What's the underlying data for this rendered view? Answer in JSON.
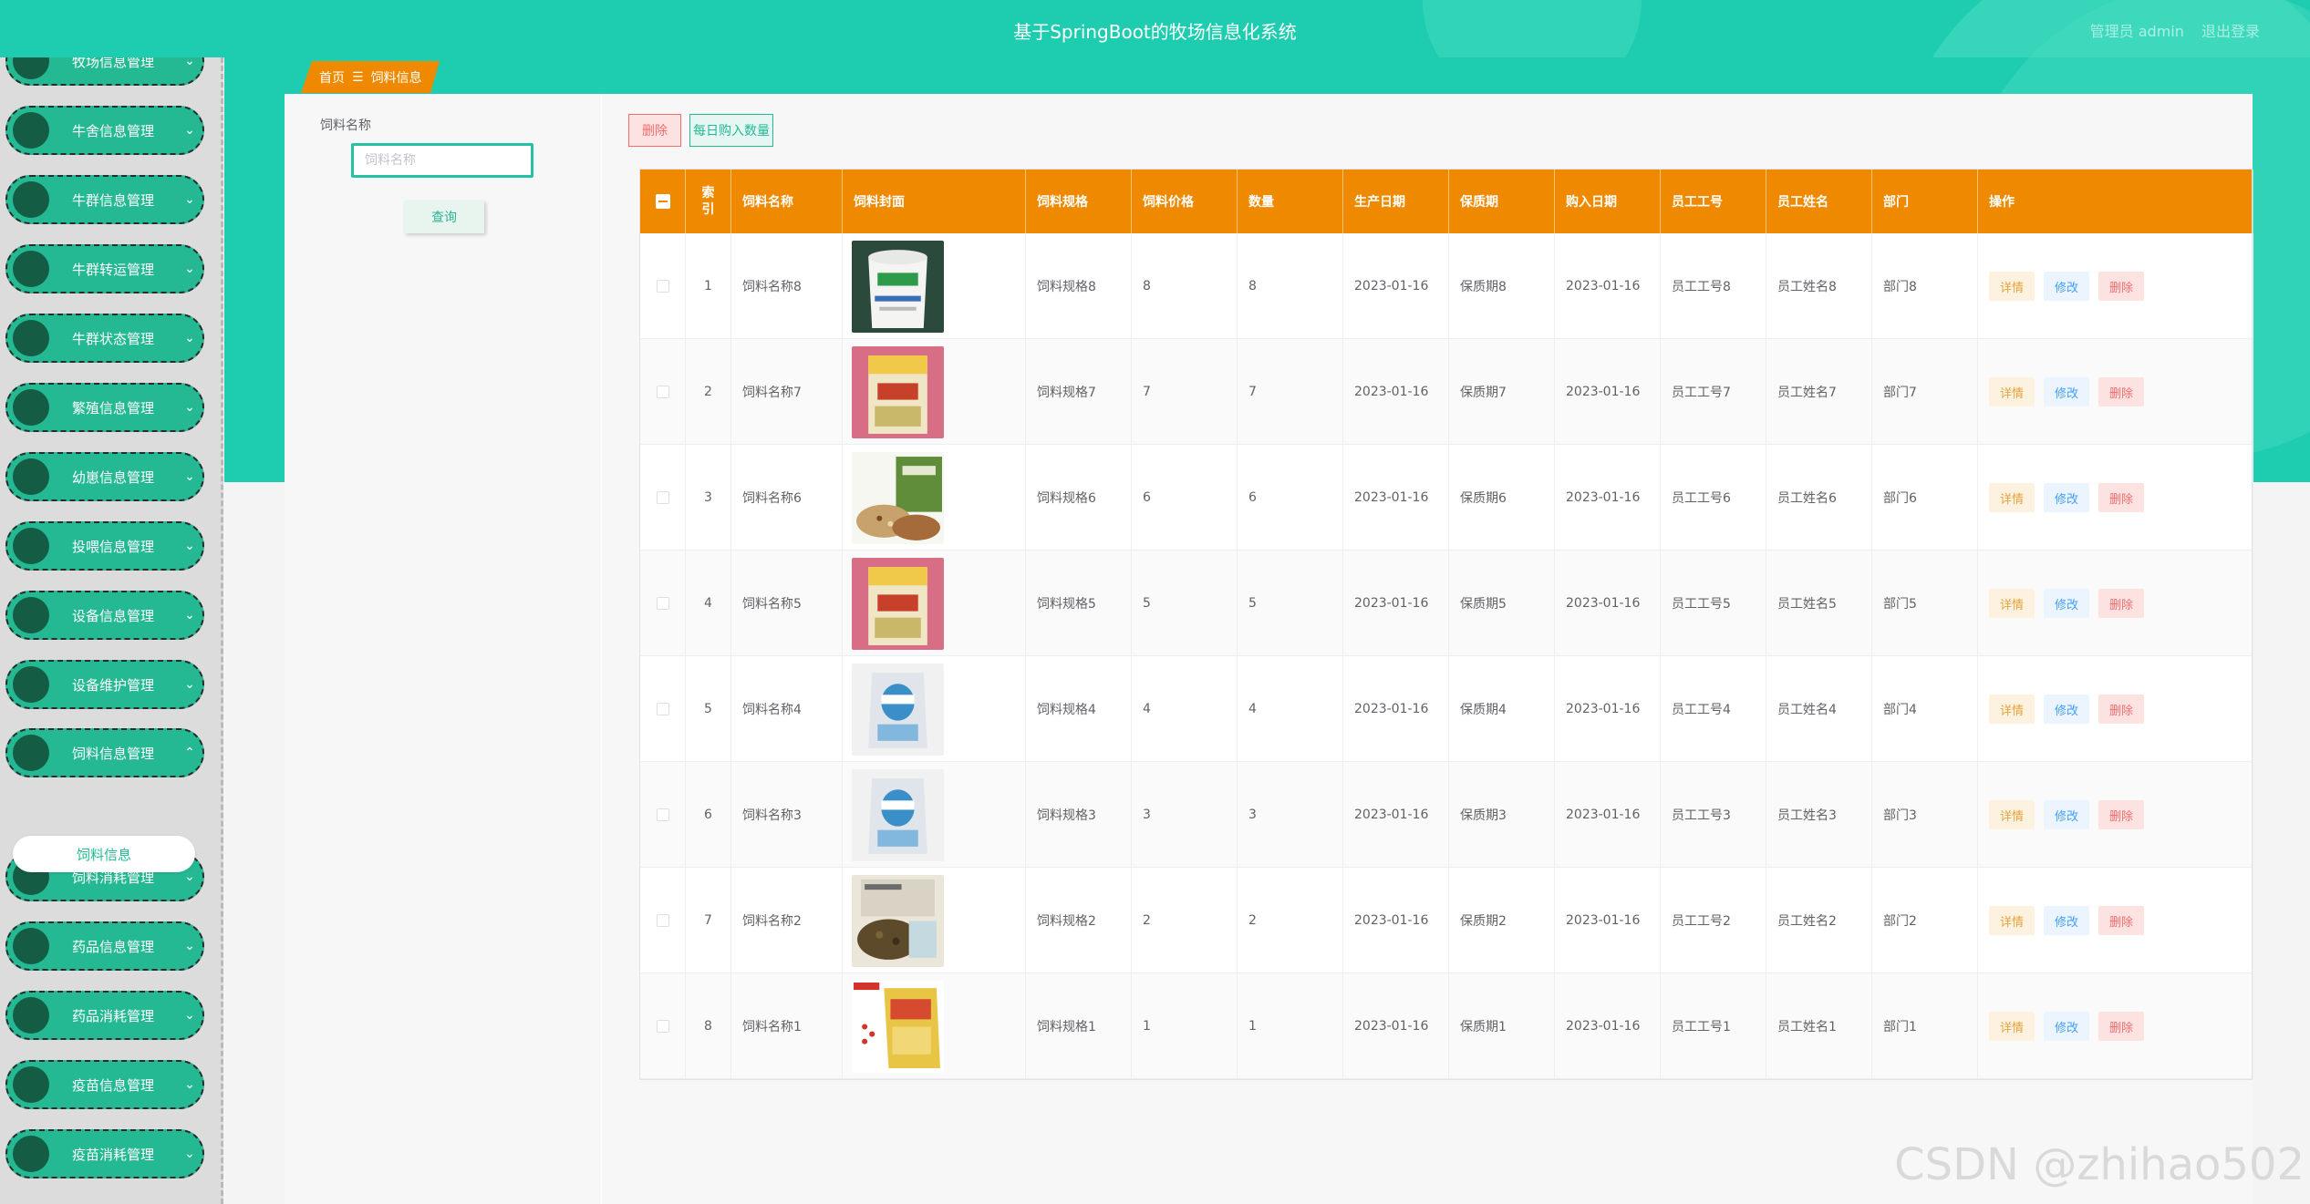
{
  "header": {
    "title": "基于SpringBoot的牧场信息化系统",
    "user_label": "管理员 admin",
    "logout_label": "退出登录"
  },
  "sidebar": {
    "items": [
      {
        "label": "牧场信息管理",
        "chevron": "chevron-down-icon"
      },
      {
        "label": "牛舍信息管理",
        "chevron": "chevron-down-icon"
      },
      {
        "label": "牛群信息管理",
        "chevron": "chevron-down-icon"
      },
      {
        "label": "牛群转运管理",
        "chevron": "chevron-down-icon"
      },
      {
        "label": "牛群状态管理",
        "chevron": "chevron-down-icon"
      },
      {
        "label": "繁殖信息管理",
        "chevron": "chevron-down-icon"
      },
      {
        "label": "幼崽信息管理",
        "chevron": "chevron-down-icon"
      },
      {
        "label": "投喂信息管理",
        "chevron": "chevron-down-icon"
      },
      {
        "label": "设备信息管理",
        "chevron": "chevron-down-icon"
      },
      {
        "label": "设备维护管理",
        "chevron": "chevron-down-icon"
      },
      {
        "label": "饲料信息管理",
        "chevron": "chevron-up-icon",
        "expanded": true
      },
      {
        "label": "饲料消耗管理",
        "chevron": "chevron-down-icon"
      },
      {
        "label": "药品信息管理",
        "chevron": "chevron-down-icon"
      },
      {
        "label": "药品消耗管理",
        "chevron": "chevron-down-icon"
      },
      {
        "label": "疫苗信息管理",
        "chevron": "chevron-down-icon"
      },
      {
        "label": "疫苗消耗管理",
        "chevron": "chevron-down-icon"
      }
    ],
    "active_sub_item": "饲料信息"
  },
  "breadcrumb": {
    "home": "首页",
    "separator": "☰",
    "current": "饲料信息"
  },
  "search": {
    "label": "饲料名称",
    "placeholder": "饲料名称",
    "value": "",
    "query_button": "查询"
  },
  "toolbar": {
    "delete_label": "删除",
    "daily_purchase_label": "每日购入数量"
  },
  "table": {
    "columns": [
      "",
      "索引",
      "饲料名称",
      "饲料封面",
      "饲料规格",
      "饲料价格",
      "数量",
      "生产日期",
      "保质期",
      "购入日期",
      "员工工号",
      "员工姓名",
      "部门",
      "操作"
    ],
    "actions": {
      "detail": "详情",
      "edit": "修改",
      "delete": "删除"
    },
    "rows": [
      {
        "index": "1",
        "name": "饲料名称8",
        "image": "white-bucket-feed",
        "spec": "饲料规格8",
        "price": "8",
        "qty": "8",
        "prod_date": "2023-01-16",
        "shelf": "保质期8",
        "buy_date": "2023-01-16",
        "emp_no": "员工工号8",
        "emp_name": "员工姓名8",
        "dept": "部门8"
      },
      {
        "index": "2",
        "name": "饲料名称7",
        "image": "pink-feed-bag",
        "spec": "饲料规格7",
        "price": "7",
        "qty": "7",
        "prod_date": "2023-01-16",
        "shelf": "保质期7",
        "buy_date": "2023-01-16",
        "emp_no": "员工工号7",
        "emp_name": "员工姓名7",
        "dept": "部门7"
      },
      {
        "index": "3",
        "name": "饲料名称6",
        "image": "green-feed-bag-grains",
        "spec": "饲料规格6",
        "price": "6",
        "qty": "6",
        "prod_date": "2023-01-16",
        "shelf": "保质期6",
        "buy_date": "2023-01-16",
        "emp_no": "员工工号6",
        "emp_name": "员工姓名6",
        "dept": "部门6"
      },
      {
        "index": "4",
        "name": "饲料名称5",
        "image": "pink-feed-bag",
        "spec": "饲料规格5",
        "price": "5",
        "qty": "5",
        "prod_date": "2023-01-16",
        "shelf": "保质期5",
        "buy_date": "2023-01-16",
        "emp_no": "员工工号5",
        "emp_name": "员工姓名5",
        "dept": "部门5"
      },
      {
        "index": "5",
        "name": "饲料名称4",
        "image": "white-blue-sack",
        "spec": "饲料规格4",
        "price": "4",
        "qty": "4",
        "prod_date": "2023-01-16",
        "shelf": "保质期4",
        "buy_date": "2023-01-16",
        "emp_no": "员工工号4",
        "emp_name": "员工姓名4",
        "dept": "部门4"
      },
      {
        "index": "6",
        "name": "饲料名称3",
        "image": "white-blue-sack",
        "spec": "饲料规格3",
        "price": "3",
        "qty": "3",
        "prod_date": "2023-01-16",
        "shelf": "保质期3",
        "buy_date": "2023-01-16",
        "emp_no": "员工工号3",
        "emp_name": "员工姓名3",
        "dept": "部门3"
      },
      {
        "index": "7",
        "name": "饲料名称2",
        "image": "carcool-feed-pellets",
        "spec": "饲料规格2",
        "price": "2",
        "qty": "2",
        "prod_date": "2023-01-16",
        "shelf": "保质期2",
        "buy_date": "2023-01-16",
        "emp_no": "员工工号2",
        "emp_name": "员工姓名2",
        "dept": "部门2"
      },
      {
        "index": "8",
        "name": "饲料名称1",
        "image": "yellow-feed-bag",
        "spec": "饲料规格1",
        "price": "1",
        "qty": "1",
        "prod_date": "2023-01-16",
        "shelf": "保质期1",
        "buy_date": "2023-01-16",
        "emp_no": "员工工号1",
        "emp_name": "员工姓名1",
        "dept": "部门1"
      }
    ]
  },
  "watermark": "CSDN @zhihao502",
  "colors": {
    "primary": "#1ecdb0",
    "menu": "#24b993",
    "table_header": "#ef8a00",
    "danger": "#f56c6c",
    "warning": "#e6a23c",
    "info": "#409eff"
  }
}
